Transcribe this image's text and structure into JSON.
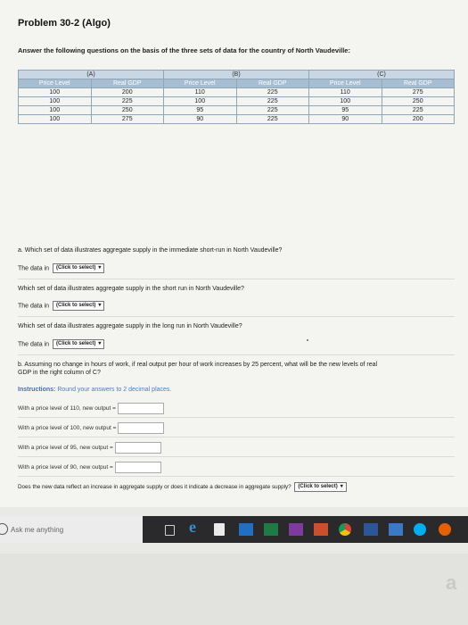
{
  "title": "Problem 30-2 (Algo)",
  "intro": "Answer the following questions on the basis of the three sets of data for the country of North Vaudeville:",
  "table": {
    "sets": [
      "(A)",
      "(B)",
      "(C)"
    ],
    "headers": [
      "Price Level",
      "Real GDP",
      "Price Level",
      "Real GDP",
      "Price Level",
      "Real GDP"
    ],
    "rows": [
      [
        "100",
        "200",
        "110",
        "225",
        "110",
        "275"
      ],
      [
        "100",
        "225",
        "100",
        "225",
        "100",
        "250"
      ],
      [
        "100",
        "250",
        "95",
        "225",
        "95",
        "225"
      ],
      [
        "100",
        "275",
        "90",
        "225",
        "90",
        "200"
      ]
    ]
  },
  "questions": {
    "a": "a. Which set of data illustrates aggregate supply in the immediate short-run in North Vaudeville?",
    "the_data_in": "The data in",
    "select_label": "(Click to select)",
    "q2": "Which set of data illustrates aggregate supply in the short run in North Vaudeville?",
    "q3": "Which set of data illustrates aggregate supply in the long run in North Vaudeville?",
    "b_line1": "b. Assuming no change in hours of work, if real output per hour of work increases by 25 percent, what will be the new levels of real",
    "b_line2": "GDP in the right column of C?",
    "instructions_label": "Instructions:",
    "instructions_text": "Round your answers to 2 decimal places.",
    "inputs": [
      "With a price level of 110, new output =",
      "With a price level of 100, new output =",
      "With a price level of 95, new output =",
      "With a price level of 90, new output ="
    ],
    "final": "Does the new data reflect an increase in aggregate supply or does it indicate a decrease in aggregate supply?"
  },
  "taskbar": {
    "search_placeholder": "Ask me anything",
    "icons": [
      "cortana-icon",
      "task-view-icon",
      "edge-icon",
      "store-icon",
      "outlook-icon",
      "excel-icon",
      "onenote-icon",
      "powerpoint-icon",
      "chrome-icon",
      "word-icon",
      "photos-icon",
      "skype-icon",
      "firefox-icon"
    ],
    "colors": {
      "edge": "#2f8fd8",
      "taskbar": "#2a2a2d"
    }
  }
}
